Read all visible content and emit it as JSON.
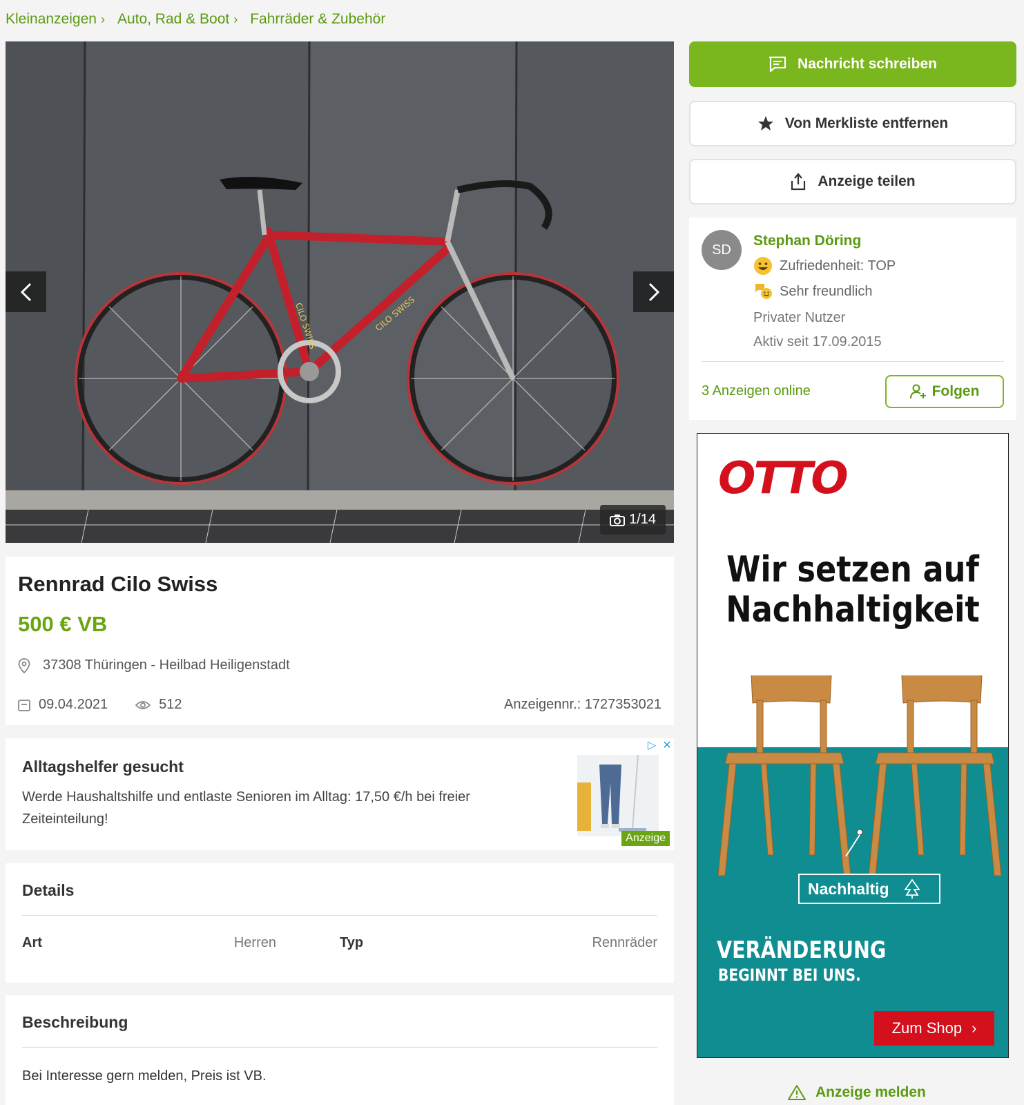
{
  "breadcrumb": [
    "Kleinanzeigen",
    "Auto, Rad & Boot",
    "Fahrräder & Zubehör"
  ],
  "gallery": {
    "counter": "1/14"
  },
  "listing": {
    "title": "Rennrad Cilo Swiss",
    "price": "500 € VB",
    "location": "37308 Thüringen - Heilbad Heiligenstadt",
    "date": "09.04.2021",
    "views": "512",
    "ad_number": "Anzeigennr.: 1727353021"
  },
  "text_ad": {
    "title": "Alltagshelfer gesucht",
    "body": "Werde Haushaltshilfe und entlaste Senioren im Alltag: 17,50 €/h bei freier Zeiteinteilung!",
    "badge": "Anzeige"
  },
  "details": {
    "heading": "Details",
    "rows": [
      {
        "key": "Art",
        "value": "Herren"
      },
      {
        "key": "Typ",
        "value": "Rennräder"
      }
    ]
  },
  "description": {
    "heading": "Beschreibung",
    "text": "Bei Interesse gern melden, Preis ist VB."
  },
  "actions": {
    "message": "Nachricht schreiben",
    "unwatch": "Von Merkliste entfernen",
    "share": "Anzeige teilen"
  },
  "seller": {
    "initials": "SD",
    "name": "Stephan Döring",
    "satisfaction": "Zufriedenheit: TOP",
    "friendly": "Sehr freundlich",
    "type": "Privater Nutzer",
    "active_since": "Aktiv seit 17.09.2015",
    "ads_online": "3 Anzeigen online",
    "follow": "Folgen"
  },
  "banner": {
    "brand": "OTTO",
    "headline_1": "Wir setzen auf",
    "headline_2": "Nachhaltigkeit",
    "tag": "Nachhaltig",
    "claim_1": "VERÄNDERUNG",
    "claim_2": "BEGINNT BEI UNS.",
    "cta": "Zum Shop"
  },
  "report": "Anzeige melden",
  "colors": {
    "accent": "#7ab61e",
    "link": "#5a9a10",
    "otto_red": "#d4101d",
    "banner_teal": "#0f8d91"
  }
}
